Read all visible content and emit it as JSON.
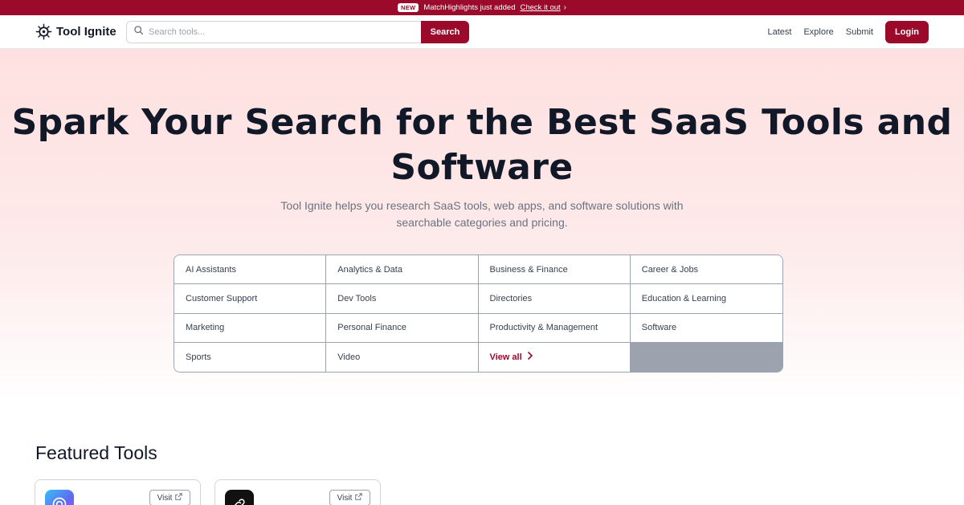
{
  "announcement": {
    "badge": "NEW",
    "text": "MatchHighlights just added",
    "link": "Check it out"
  },
  "header": {
    "logo_text": "Tool Ignite",
    "search_placeholder": "Search tools...",
    "search_button": "Search",
    "nav": [
      "Latest",
      "Explore",
      "Submit"
    ],
    "login": "Login"
  },
  "hero": {
    "title": "Spark Your Search for the Best SaaS Tools and Software",
    "subtitle": "Tool Ignite helps you research SaaS tools, web apps, and software solutions with searchable categories and pricing."
  },
  "categories": [
    "AI Assistants",
    "Analytics & Data",
    "Business & Finance",
    "Career & Jobs",
    "Customer Support",
    "Dev Tools",
    "Directories",
    "Education & Learning",
    "Marketing",
    "Personal Finance",
    "Productivity & Management",
    "Software",
    "Sports",
    "Video"
  ],
  "view_all": "View all",
  "featured": {
    "title": "Featured Tools",
    "cards": [
      {
        "visit": "Visit",
        "icon": "gear-app-icon"
      },
      {
        "visit": "Visit",
        "icon": "link-app-icon"
      }
    ]
  },
  "colors": {
    "brand": "#9b0a2a",
    "hero_top": "#ffe0e0"
  }
}
